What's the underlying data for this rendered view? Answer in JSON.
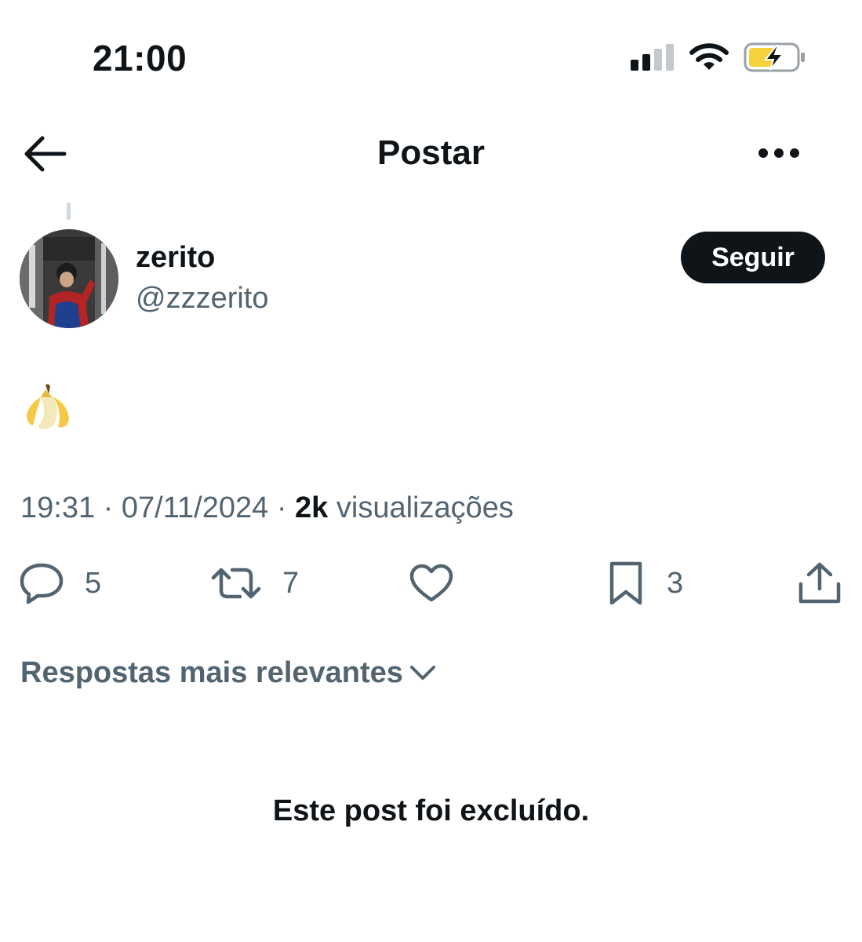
{
  "status_bar": {
    "time": "21:00",
    "icons": [
      "cellular-signal-icon",
      "wifi-icon",
      "battery-charging-icon"
    ]
  },
  "header": {
    "title": "Postar",
    "back_icon": "arrow-left-icon",
    "more_icon": "ellipsis-icon"
  },
  "post": {
    "author": {
      "display_name": "zerito",
      "handle": "@zzzerito",
      "avatar_icon": "avatar-photo"
    },
    "follow_label": "Seguir",
    "text": "🍌",
    "time": "19:31",
    "separator": "·",
    "date": "07/11/2024",
    "views_count": "2k",
    "views_label": "visualizações",
    "actions": {
      "replies": "5",
      "reposts": "7",
      "bookmarks": "3"
    }
  },
  "replies": {
    "sort_label": "Respostas mais relevantes",
    "deleted_message": "Este post foi excluído."
  },
  "colors": {
    "text_primary": "#0f1419",
    "text_secondary": "#536471",
    "button_bg": "#0f1419",
    "battery_fill": "#f5d13d"
  }
}
